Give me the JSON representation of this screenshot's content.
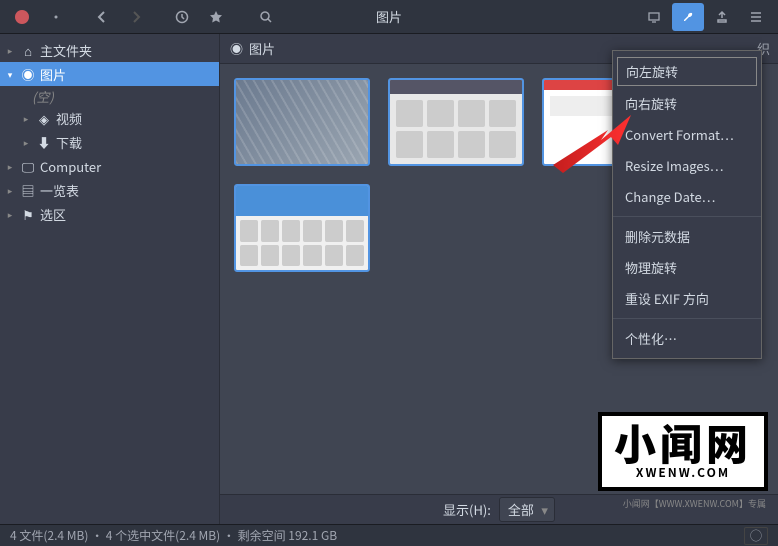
{
  "window": {
    "title": "图片"
  },
  "sidebar": {
    "items": [
      {
        "label": "主文件夹",
        "icon": "home"
      },
      {
        "label": "图片",
        "icon": "camera",
        "selected": true,
        "empty_label": "(空)"
      },
      {
        "label": "视频",
        "icon": "video",
        "indent": true
      },
      {
        "label": "下载",
        "icon": "download",
        "indent": true
      },
      {
        "label": "Computer",
        "icon": "computer"
      },
      {
        "label": "一览表",
        "icon": "list"
      },
      {
        "label": "选区",
        "icon": "flag"
      }
    ]
  },
  "breadcrumb": {
    "location": "图片",
    "right_label": "织"
  },
  "filter": {
    "label": "显示(H):",
    "value": "全部"
  },
  "status": {
    "text": "4 文件(2.4 MB) · 4 个选中文件(2.4 MB) · 剩余空间 192.1 GB"
  },
  "menu": {
    "items": [
      {
        "label": "向左旋转",
        "highlighted": true
      },
      {
        "label": "向右旋转"
      },
      {
        "label": "Convert Format…"
      },
      {
        "label": "Resize Images…"
      },
      {
        "label": "Change Date…"
      },
      {
        "sep": true
      },
      {
        "label": "删除元数据"
      },
      {
        "label": "物理旋转"
      },
      {
        "label": "重设 EXIF 方向"
      },
      {
        "sep": true
      },
      {
        "label": "个性化…"
      }
    ]
  },
  "watermark": {
    "big": "小闻网",
    "small": "XWENW.COM",
    "sub": "小闻网【WWW.XWENW.COM】专属"
  }
}
